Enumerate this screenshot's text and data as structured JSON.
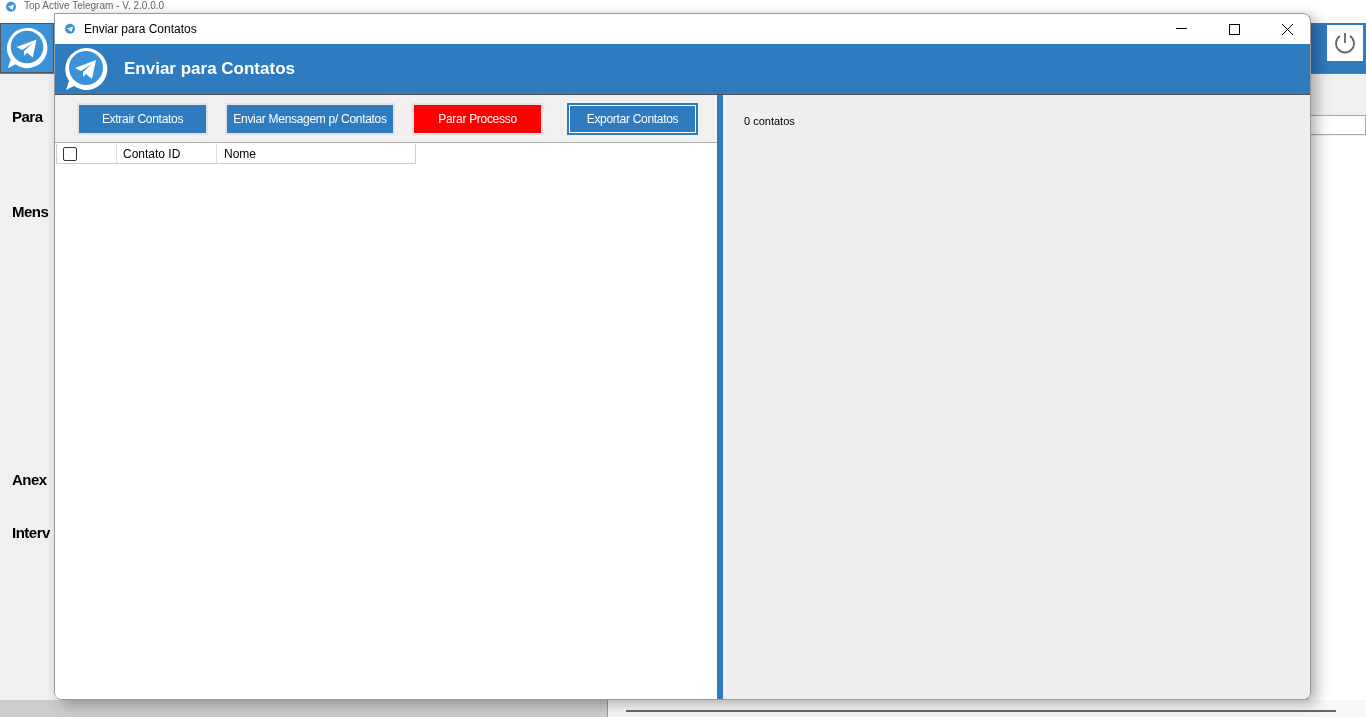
{
  "background_window": {
    "title": "Top Active Telegram - V. 2.0.0.0",
    "labels": [
      "Para",
      "Mens",
      "Anex",
      "Interv"
    ]
  },
  "dialog": {
    "title": "Enviar para Contatos",
    "header": "Enviar para Contatos",
    "buttons": [
      {
        "label": "Extrair Contatos",
        "kind": "normal",
        "focused": false
      },
      {
        "label": "Enviar Mensagem p/ Contatos",
        "kind": "normal",
        "focused": false
      },
      {
        "label": "Parar Processo",
        "kind": "danger",
        "focused": false
      },
      {
        "label": "Exportar Contatos",
        "kind": "normal",
        "focused": true
      }
    ],
    "table": {
      "select_all_checked": false,
      "columns": [
        "Contato ID",
        "Nome"
      ]
    },
    "count": "0 contatos"
  }
}
